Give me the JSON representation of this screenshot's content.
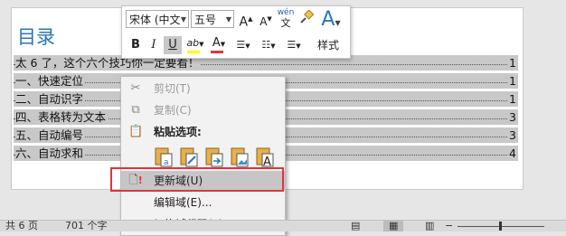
{
  "toc": {
    "title": "目录",
    "entries": [
      {
        "label": "太 6 了，这个六个技巧你一定要看！",
        "page": "1"
      },
      {
        "label": "一、快速定位",
        "page": "1"
      },
      {
        "label": "二、自动识字",
        "page": "1"
      },
      {
        "label": "四、表格转为文本",
        "page": "3"
      },
      {
        "label": "五、自动编号",
        "page": "3"
      },
      {
        "label": "六、自动求和",
        "page": "4"
      }
    ]
  },
  "mini_toolbar": {
    "font_name": "宋体 (中文",
    "font_size": "五号",
    "bold": "B",
    "italic": "I",
    "wen_label": "wén",
    "wen_char": "文",
    "styles_label": "样式"
  },
  "context_menu": {
    "cut": "剪切(T)",
    "copy": "复制(C)",
    "paste_options": "粘贴选项:",
    "update_field": "更新域(U)",
    "edit_field": "编辑域(E)...",
    "toggle_codes": "切换域代码(T)"
  },
  "status_bar": {
    "page": "共 6 页",
    "words": "701 个字"
  },
  "colors": {
    "title_blue": "#2e75b6",
    "highlight_red": "#e0353a",
    "field_shade": "#c8c8c8"
  }
}
